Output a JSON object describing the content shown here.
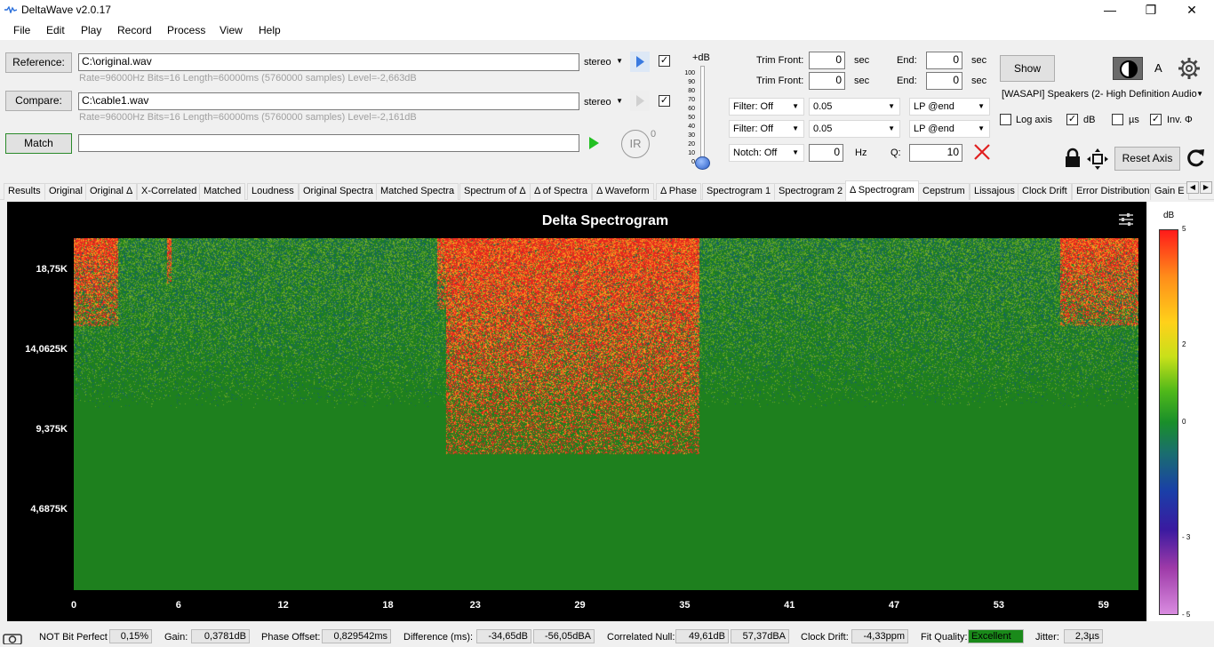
{
  "window": {
    "title": "DeltaWave v2.0.17"
  },
  "menu": [
    "File",
    "Edit",
    "Play",
    "Record",
    "Process",
    "View",
    "Help"
  ],
  "reference": {
    "button": "Reference:",
    "path": "C:\\original.wav",
    "channel": "stereo",
    "info": "Rate=96000Hz Bits=16 Length=60000ms (5760000 samples) Level=-2,663dB",
    "checked": true
  },
  "compare": {
    "button": "Compare:",
    "path": "C:\\cable1.wav",
    "channel": "stereo",
    "info": "Rate=96000Hz Bits=16 Length=60000ms (5760000 samples) Level=-2,161dB",
    "checked": true
  },
  "match": {
    "button": "Match",
    "value": ""
  },
  "ir": {
    "label": "IR",
    "sup": "0"
  },
  "volume": {
    "label": "+dB",
    "ticks": [
      "100",
      "90",
      "80",
      "70",
      "60",
      "50",
      "40",
      "30",
      "20",
      "10",
      "0"
    ]
  },
  "trim": [
    {
      "front_label": "Trim Front:",
      "front_value": "0",
      "front_unit": "sec",
      "end_label": "End:",
      "end_value": "0",
      "end_unit": "sec"
    },
    {
      "front_label": "Trim Front:",
      "front_value": "0",
      "front_unit": "sec",
      "end_label": "End:",
      "end_value": "0",
      "end_unit": "sec"
    }
  ],
  "filters": [
    {
      "type": "Filter: Off",
      "value": "0.05",
      "mode": "LP @end"
    },
    {
      "type": "Filter: Off",
      "value": "0.05",
      "mode": "LP @end"
    }
  ],
  "notch": {
    "type": "Notch: Off",
    "value": "0",
    "unit": "Hz",
    "q_label": "Q:",
    "q_value": "10"
  },
  "output": {
    "show": "Show",
    "device": "[WASAPI] Speakers (2- High Definition Audio",
    "font_label": "A",
    "log_axis": {
      "label": "Log axis",
      "checked": false
    },
    "db": {
      "label": "dB",
      "checked": true
    },
    "us": {
      "label": "µs",
      "checked": false
    },
    "inv": {
      "label": "Inv. Φ",
      "checked": true
    },
    "reset_axis": "Reset Axis"
  },
  "tabs": [
    "Results",
    "Original",
    "Original Δ",
    "X-Correlated",
    "Matched",
    "Loudness",
    "Original Spectra",
    "Matched Spectra",
    "Spectrum of Δ",
    "Δ of Spectra",
    "Δ Waveform",
    "Δ Phase",
    "Spectrogram 1",
    "Spectrogram 2",
    "Δ Spectrogram",
    "Cepstrum",
    "Lissajous",
    "Clock Drift",
    "Error Distribution",
    "Gain E"
  ],
  "active_tab": "Δ Spectrogram",
  "chart_data": {
    "type": "heatmap",
    "title": "Delta Spectrogram",
    "xlabel": "",
    "ylabel": "",
    "x_ticks": [
      "0",
      "6",
      "12",
      "18",
      "23",
      "29",
      "35",
      "41",
      "47",
      "53",
      "59"
    ],
    "y_ticks": [
      "18,75K",
      "14,0625K",
      "9,375K",
      "4,6875K"
    ],
    "xlim": [
      0,
      60
    ],
    "ylim": [
      0,
      20625
    ],
    "colorbar": {
      "label": "dB",
      "ticks": [
        "5",
        "2",
        "0",
        "- 3",
        "- 5"
      ],
      "range": [
        -5,
        5
      ]
    },
    "dominant_value": 0,
    "hot_regions": [
      {
        "x": [
          0,
          2.5
        ],
        "y_from": 15500,
        "y_to": 20625,
        "value": 5
      },
      {
        "x": [
          5.3,
          5.6
        ],
        "y_from": 18000,
        "y_to": 20625,
        "value": 5
      },
      {
        "x": [
          20.8,
          21.3
        ],
        "y_from": 16500,
        "y_to": 20625,
        "value": 5
      },
      {
        "x": [
          21.3,
          35.8
        ],
        "y_from": 8000,
        "y_to": 20625,
        "value": 5
      },
      {
        "x": [
          56.5,
          61
        ],
        "y_from": 15500,
        "y_to": 20625,
        "value": 5
      }
    ]
  },
  "status": {
    "bit_perfect": "NOT Bit Perfect",
    "bit_perfect_value": "0,15%",
    "gain_label": "Gain:",
    "gain_value": "0,3781dB",
    "phase_label": "Phase Offset:",
    "phase_value": "0,829542ms",
    "diff_label": "Difference (ms):",
    "diff_value1": "-34,65dB",
    "diff_value2": "-56,05dBA",
    "null_label": "Correlated Null:",
    "null_value1": "49,61dB",
    "null_value2": "57,37dBA",
    "drift_label": "Clock Drift:",
    "drift_value": "-4,33ppm",
    "fit_label": "Fit Quality:",
    "fit_value": "Excellent",
    "jitter_label": "Jitter:",
    "jitter_value": "2,3µs"
  },
  "colors": {
    "accent": "#0078d7",
    "fit_good": "#1a8a1a",
    "plot_bg": "#000000",
    "heat_base": "#1f7a1f"
  }
}
